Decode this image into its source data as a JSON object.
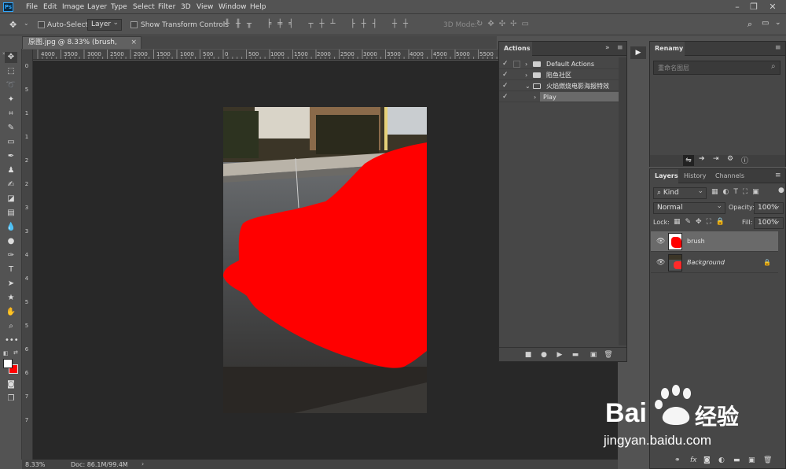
{
  "app": {
    "logo": "Ps",
    "menus": [
      "File",
      "Edit",
      "Image",
      "Layer",
      "Type",
      "Select",
      "Filter",
      "3D",
      "View",
      "Window",
      "Help"
    ]
  },
  "options": {
    "auto_select_label": "Auto-Select:",
    "auto_select_value": "Layer",
    "transform_label": "Show Transform Controls",
    "mode3d_label": "3D Mode:"
  },
  "document": {
    "tab_title": "原图.jpg @ 8.33% (brush, RGB/8) *",
    "ruler_h": [
      "4000",
      "3500",
      "3000",
      "2500",
      "2000",
      "1500",
      "1000",
      "500",
      "0",
      "500",
      "1000",
      "1500",
      "2000",
      "2500",
      "3000",
      "3500",
      "4000",
      "4500",
      "5000",
      "5500",
      "6000",
      "6500",
      "7000",
      "7500",
      "8000"
    ],
    "ruler_v": [
      "0",
      "5",
      "1",
      "1",
      "2",
      "2",
      "3",
      "3",
      "4",
      "4",
      "5",
      "5",
      "6",
      "6",
      "7",
      "7"
    ],
    "zoom": "8.33%",
    "doc_size": "Doc: 86.1M/99.4M"
  },
  "actions_panel": {
    "title": "Actions",
    "rows": [
      {
        "checked": true,
        "label": "Default Actions",
        "type": "set",
        "expanded": false
      },
      {
        "checked": true,
        "label": "陷鱼社区",
        "type": "set",
        "expanded": false
      },
      {
        "checked": true,
        "label": "火焰燃烧电影海报特效",
        "type": "set",
        "expanded": true
      },
      {
        "checked": true,
        "label": "Play",
        "type": "action",
        "expanded": false
      }
    ]
  },
  "renamy_panel": {
    "title": "Renamy",
    "search_placeholder": "重命名图层"
  },
  "layers_panel": {
    "tabs": [
      "Layers",
      "History",
      "Channels"
    ],
    "active_tab": "Layers",
    "filter_kind": "Kind",
    "blend_mode": "Normal",
    "opacity_label": "Opacity:",
    "opacity_value": "100%",
    "lock_label": "Lock:",
    "fill_label": "Fill:",
    "fill_value": "100%",
    "layers": [
      {
        "name": "brush",
        "selected": true,
        "locked": false
      },
      {
        "name": "Background",
        "selected": false,
        "locked": true
      }
    ],
    "bottom_fx": "fx"
  },
  "watermark": {
    "brand_left": "Bai",
    "brand_right": "经验",
    "url": "jingyan.baidu.com"
  },
  "colors": {
    "accent": "#31a8ff",
    "brush_red": "#ff0000",
    "selected_row": "#6a6a6a"
  }
}
